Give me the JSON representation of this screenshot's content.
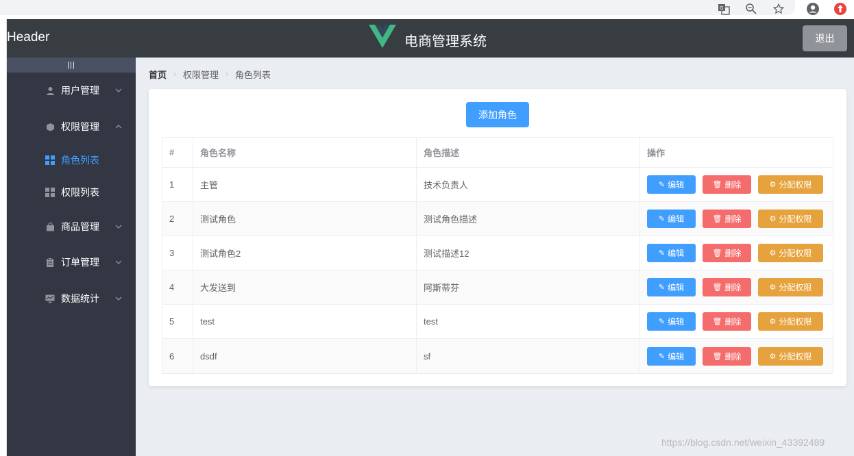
{
  "header": {
    "title": "Header",
    "app_name": "电商管理系统",
    "logout": "退出"
  },
  "sidebar": {
    "toggle": "|||",
    "menus": [
      {
        "label": "用户管理"
      },
      {
        "label": "权限管理"
      },
      {
        "label": "商品管理"
      },
      {
        "label": "订单管理"
      },
      {
        "label": "数据统计"
      }
    ],
    "sub_items": [
      {
        "label": "角色列表"
      },
      {
        "label": "权限列表"
      }
    ]
  },
  "breadcrumb": [
    "首页",
    "权限管理",
    "角色列表"
  ],
  "main": {
    "add_button": "添加角色",
    "columns": [
      "#",
      "角色名称",
      "角色描述",
      "操作"
    ],
    "rows": [
      {
        "idx": "1",
        "name": "主管",
        "desc": "技术负责人"
      },
      {
        "idx": "2",
        "name": "测试角色",
        "desc": "测试角色描述"
      },
      {
        "idx": "3",
        "name": "测试角色2",
        "desc": "测试描述12"
      },
      {
        "idx": "4",
        "name": "大发送到",
        "desc": "阿斯蒂芬"
      },
      {
        "idx": "5",
        "name": "test",
        "desc": "test"
      },
      {
        "idx": "6",
        "name": "dsdf",
        "desc": "sf"
      }
    ],
    "ops": {
      "edit": "编辑",
      "delete": "删除",
      "assign": "分配权限"
    }
  },
  "watermark": "https://blog.csdn.net/weixin_43392489",
  "colors": {
    "primary": "#409eff",
    "danger": "#f56c6c",
    "warning": "#e6a23c",
    "header_bg": "#373d41",
    "sidebar_bg": "#333744"
  }
}
